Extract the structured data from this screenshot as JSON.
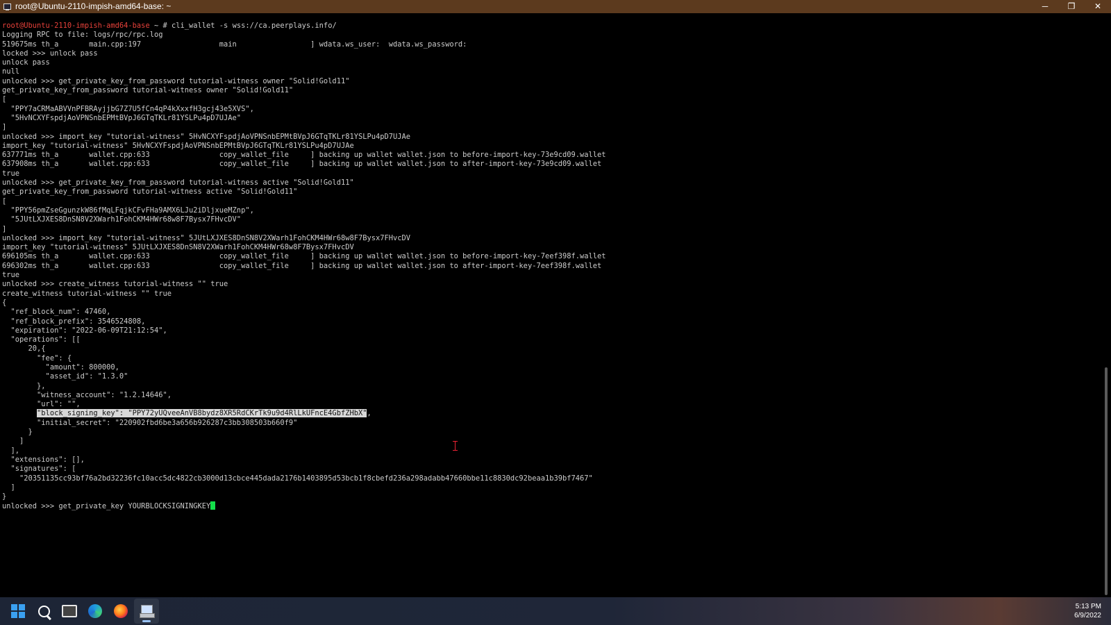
{
  "window": {
    "title": "root@Ubuntu-2110-impish-amd64-base: ~",
    "minimize_glyph": "─",
    "restore_glyph": "❐",
    "close_glyph": "✕"
  },
  "terminal": {
    "prompt": {
      "user_host": "root@Ubuntu-2110-impish-amd64-base",
      "path": " ~ # ",
      "command": "cli_wallet -s wss://ca.peerplays.info/"
    },
    "lines": [
      "Logging RPC to file: logs/rpc/rpc.log",
      "519675ms th_a       main.cpp:197                  main                 ] wdata.ws_user:  wdata.ws_password:",
      "locked >>> unlock pass",
      "unlock pass",
      "null",
      "unlocked >>> get_private_key_from_password tutorial-witness owner \"Solid!Gold11\"",
      "get_private_key_from_password tutorial-witness owner \"Solid!Gold11\"",
      "[",
      "  \"PPY7aCRMaABVVnPFBRAyjjbG7Z7U5fCn4qP4kXxxfH3gcj43e5XVS\",",
      "  \"5HvNCXYFspdjAoVPNSnbEPMtBVpJ6GTqTKLr81YSLPu4pD7UJAe\"",
      "]",
      "unlocked >>> import_key \"tutorial-witness\" 5HvNCXYFspdjAoVPNSnbEPMtBVpJ6GTqTKLr81YSLPu4pD7UJAe",
      "import_key \"tutorial-witness\" 5HvNCXYFspdjAoVPNSnbEPMtBVpJ6GTqTKLr81YSLPu4pD7UJAe",
      "637771ms th_a       wallet.cpp:633                copy_wallet_file     ] backing up wallet wallet.json to before-import-key-73e9cd09.wallet",
      "637908ms th_a       wallet.cpp:633                copy_wallet_file     ] backing up wallet wallet.json to after-import-key-73e9cd09.wallet",
      "true",
      "unlocked >>> get_private_key_from_password tutorial-witness active \"Solid!Gold11\"",
      "get_private_key_from_password tutorial-witness active \"Solid!Gold11\"",
      "[",
      "  \"PPY56pmZseGgunzkW86fMqLFqjkCFvFHa9AMX6LJu2iDljxueMZnp\",",
      "  \"5JUtLXJXES8DnSN8V2XWarh1FohCKM4HWr68w8F7Bysx7FHvcDV\"",
      "]",
      "unlocked >>> import_key \"tutorial-witness\" 5JUtLXJXES8DnSN8V2XWarh1FohCKM4HWr68w8F7Bysx7FHvcDV",
      "import_key \"tutorial-witness\" 5JUtLXJXES8DnSN8V2XWarh1FohCKM4HWr68w8F7Bysx7FHvcDV",
      "696105ms th_a       wallet.cpp:633                copy_wallet_file     ] backing up wallet wallet.json to before-import-key-7eef398f.wallet",
      "696302ms th_a       wallet.cpp:633                copy_wallet_file     ] backing up wallet wallet.json to after-import-key-7eef398f.wallet",
      "true",
      "unlocked >>> create_witness tutorial-witness \"\" true",
      "create_witness tutorial-witness \"\" true",
      "{",
      "  \"ref_block_num\": 47460,",
      "  \"ref_block_prefix\": 3546524808,",
      "  \"expiration\": \"2022-06-09T21:12:54\",",
      "  \"operations\": [[",
      "      20,{",
      "        \"fee\": {",
      "          \"amount\": 800000,",
      "          \"asset_id\": \"1.3.0\"",
      "        },",
      "        \"witness_account\": \"1.2.14646\",",
      "        \"url\": \"\","
    ],
    "highlight_line": {
      "indent": "        ",
      "selected": "\"block_signing_key\": \"PPY72yUQveeAnVB8bydz8XR5RdCKrTk9u9d4RlLkUFncE4GbfZHbX\"",
      "rest": ","
    },
    "lines_after": [
      "        \"initial_secret\": \"220902fbd6be3a656b926287c3bb308503b660f9\"",
      "      }",
      "    ]",
      "  ],",
      "  \"extensions\": [],",
      "  \"signatures\": [",
      "    \"20351135cc93bf76a2bd32236fc10acc5dc4822cb3000d13cbce445dada2176b1403895d53bcb1f8cbefd236a298adabb47660bbe11c8830dc92beaa1b39bf7467\"",
      "  ]",
      "}"
    ],
    "last_prompt": "unlocked >>> get_private_key YOURBLOCKSIGNINGKEY"
  },
  "taskbar": {
    "icons": [
      "windows-start-icon",
      "search-icon",
      "task-view-icon",
      "edge-icon",
      "firefox-icon",
      "putty-icon"
    ],
    "time": "5:13 PM",
    "date": "6/9/2022"
  }
}
